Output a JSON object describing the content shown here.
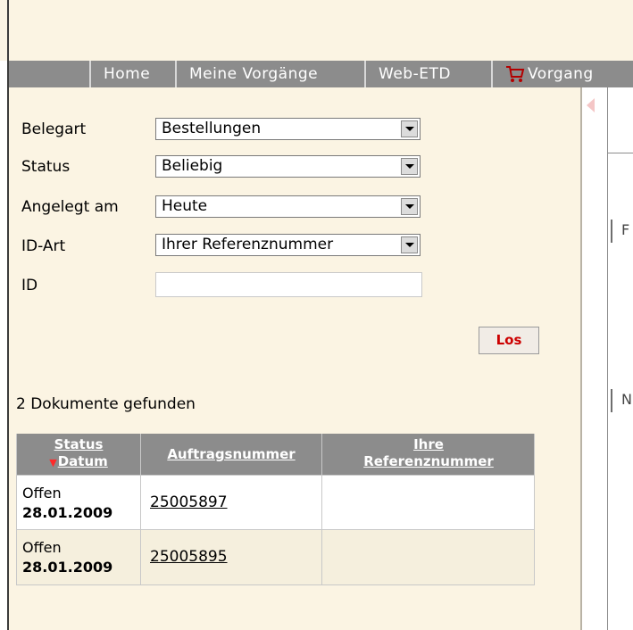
{
  "nav": {
    "items": [
      "Home",
      "Meine Vorgänge",
      "Web-ETD",
      "Vorgang"
    ]
  },
  "form": {
    "belegart": {
      "label": "Belegart",
      "value": "Bestellungen"
    },
    "status": {
      "label": "Status",
      "value": "Beliebig"
    },
    "angelegt": {
      "label": "Angelegt am",
      "value": "Heute"
    },
    "idart": {
      "label": "ID-Art",
      "value": "Ihrer Referenznummer"
    },
    "id": {
      "label": "ID",
      "value": ""
    },
    "submit_label": "Los"
  },
  "results": {
    "count_text": "2 Dokumente gefunden",
    "headers": {
      "status": "Status",
      "datum": "Datum",
      "auftrag": "Auftragsnummer",
      "ref": "Ihre Referenznummer"
    },
    "rows": [
      {
        "status": "Offen",
        "datum": "28.01.2009",
        "auftrag": "25005897",
        "ref": ""
      },
      {
        "status": "Offen",
        "datum": "28.01.2009",
        "auftrag": "25005895",
        "ref": ""
      }
    ]
  },
  "right_panel": {
    "box1": "F",
    "box2": "N"
  },
  "colors": {
    "background": "#fbf4e3",
    "nav": "#8c8c8c",
    "accent_red": "#cc0000",
    "row_alt": "#f5efdd"
  },
  "icons": {
    "cart": "shopping-cart-icon",
    "sort": "sort-down-icon",
    "dropdown": "chevron-down-icon"
  }
}
